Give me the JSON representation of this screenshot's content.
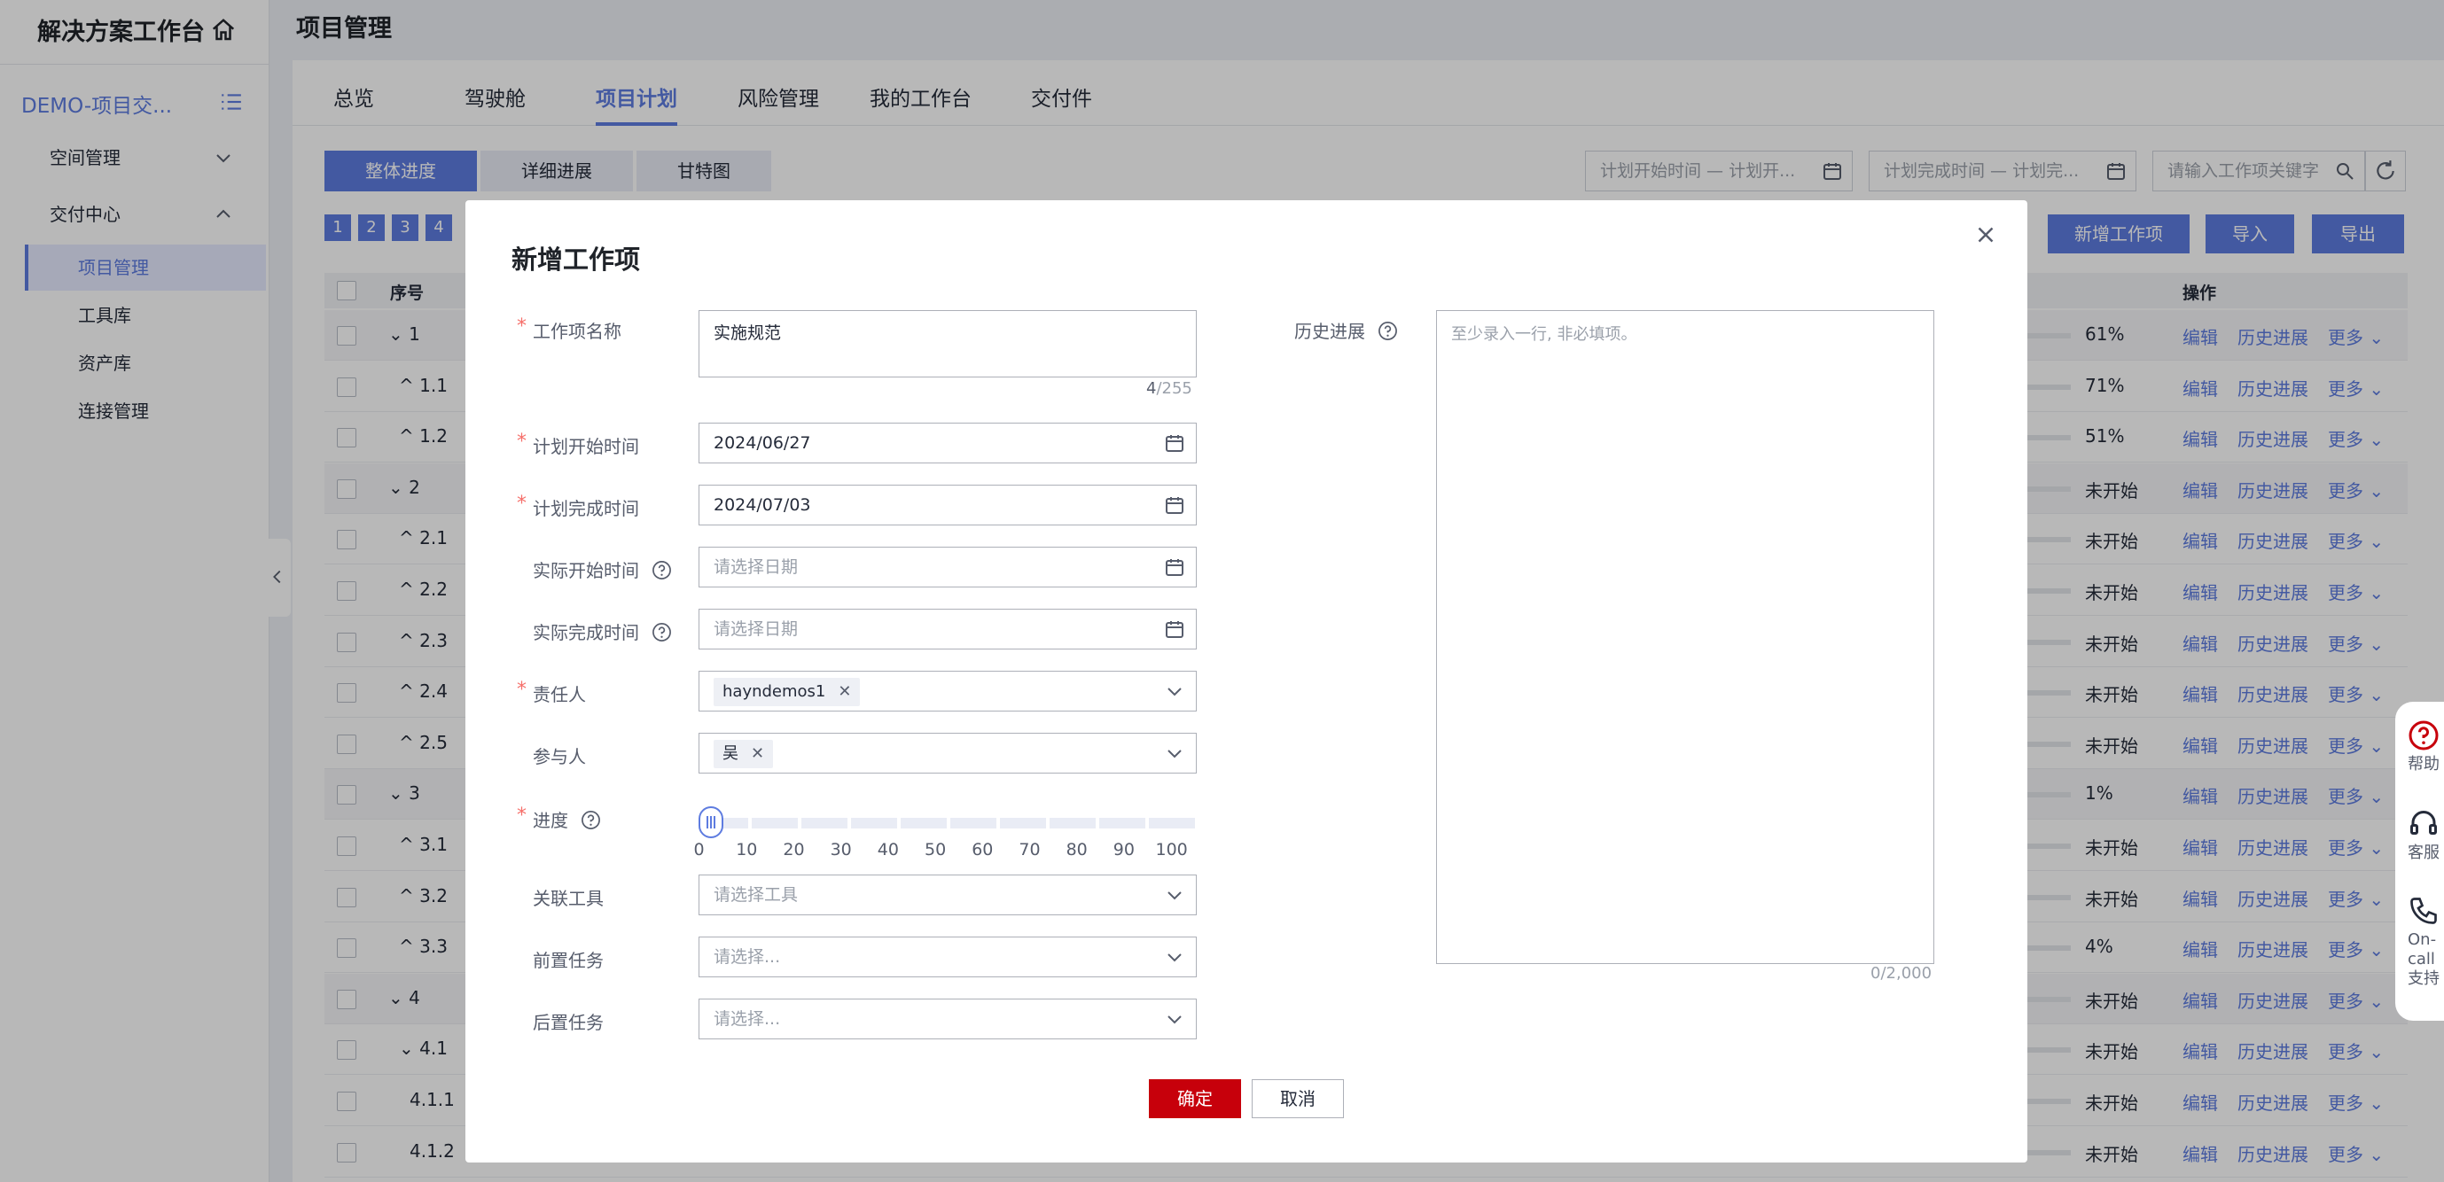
{
  "sidebar": {
    "title": "解决方案工作台",
    "project": "DEMO-项目交...",
    "groups": [
      {
        "label": "空间管理",
        "expanded": false
      },
      {
        "label": "交付中心",
        "expanded": true
      }
    ],
    "items": [
      {
        "label": "项目管理",
        "active": true
      },
      {
        "label": "工具库",
        "active": false
      },
      {
        "label": "资产库",
        "active": false
      },
      {
        "label": "连接管理",
        "active": false
      }
    ]
  },
  "header": {
    "title": "项目管理",
    "tabs": [
      "总览",
      "驾驶舱",
      "项目计划",
      "风险管理",
      "我的工作台",
      "交付件"
    ],
    "active_tab": "项目计划"
  },
  "toolbar": {
    "segments": [
      "整体进度",
      "详细进展",
      "甘特图"
    ],
    "filter_start": "计划开始时间 — 计划开...",
    "filter_end": "计划完成时间 — 计划完...",
    "search_placeholder": "请输入工作项关键字",
    "pages": [
      "1",
      "2",
      "3",
      "4"
    ],
    "add_button": "新增工作项",
    "import_button": "导入",
    "export_button": "导出"
  },
  "table": {
    "col_seq": "序号",
    "col_ops": "操作",
    "ops": {
      "edit": "编辑",
      "history": "历史进展",
      "more": "更多"
    },
    "rows": [
      {
        "seq": "1",
        "level": 0,
        "expand": "v",
        "progress": "61%",
        "fill": 0.61
      },
      {
        "seq": "1.1",
        "level": 1,
        "expand": "^",
        "progress": "71%",
        "fill": 0.71
      },
      {
        "seq": "1.2",
        "level": 1,
        "expand": "^",
        "progress": "51%",
        "fill": 0.51
      },
      {
        "seq": "2",
        "level": 0,
        "expand": "v",
        "progress": "未开始",
        "fill": 0
      },
      {
        "seq": "2.1",
        "level": 1,
        "expand": "^",
        "progress": "未开始",
        "fill": 0
      },
      {
        "seq": "2.2",
        "level": 1,
        "expand": "^",
        "progress": "未开始",
        "fill": 0
      },
      {
        "seq": "2.3",
        "level": 1,
        "expand": "^",
        "progress": "未开始",
        "fill": 0
      },
      {
        "seq": "2.4",
        "level": 1,
        "expand": "^",
        "progress": "未开始",
        "fill": 0
      },
      {
        "seq": "2.5",
        "level": 1,
        "expand": "^",
        "progress": "未开始",
        "fill": 0
      },
      {
        "seq": "3",
        "level": 0,
        "expand": "v",
        "progress": "1%",
        "fill": 0.01
      },
      {
        "seq": "3.1",
        "level": 1,
        "expand": "^",
        "progress": "未开始",
        "fill": 0
      },
      {
        "seq": "3.2",
        "level": 1,
        "expand": "^",
        "progress": "未开始",
        "fill": 0
      },
      {
        "seq": "3.3",
        "level": 1,
        "expand": "^",
        "progress": "4%",
        "fill": 0.04
      },
      {
        "seq": "4",
        "level": 0,
        "expand": "v",
        "progress": "未开始",
        "fill": 0
      },
      {
        "seq": "4.1",
        "level": 1,
        "expand": "v",
        "progress": "未开始",
        "fill": 0
      },
      {
        "seq": "4.1.1",
        "level": 2,
        "expand": "",
        "progress": "未开始",
        "fill": 0
      },
      {
        "seq": "4.1.2",
        "level": 2,
        "expand": "",
        "progress": "未开始",
        "fill": 0
      }
    ]
  },
  "modal": {
    "title": "新增工作项",
    "name_label": "工作项名称",
    "name_value": "实施规范",
    "name_count": "4",
    "name_max": "/255",
    "plan_start_label": "计划开始时间",
    "plan_start_value": "2024/06/27",
    "plan_end_label": "计划完成时间",
    "plan_end_value": "2024/07/03",
    "actual_start_label": "实际开始时间",
    "actual_start_placeholder": "请选择日期",
    "actual_end_label": "实际完成时间",
    "actual_end_placeholder": "请选择日期",
    "owner_label": "责任人",
    "owner_tag": "hayndemos1",
    "participant_label": "参与人",
    "participant_tag": "吴",
    "progress_label": "进度",
    "progress_value": 0,
    "progress_ticks": [
      "0",
      "10",
      "20",
      "30",
      "40",
      "50",
      "60",
      "70",
      "80",
      "90",
      "100"
    ],
    "tool_label": "关联工具",
    "tool_placeholder": "请选择工具",
    "pre_label": "前置任务",
    "pre_placeholder": "请选择...",
    "post_label": "后置任务",
    "post_placeholder": "请选择...",
    "history_label": "历史进展",
    "history_placeholder": "至少录入一行, 非必填项。",
    "history_count": "0/2,000",
    "ok_label": "确定",
    "cancel_label": "取消"
  },
  "floatbar": {
    "help": "帮助",
    "service": "客服",
    "oncall": "On-call支持"
  },
  "colors": {
    "accent": "#5e7ce0",
    "danger": "#c7000b",
    "required": "#f66f6a"
  }
}
